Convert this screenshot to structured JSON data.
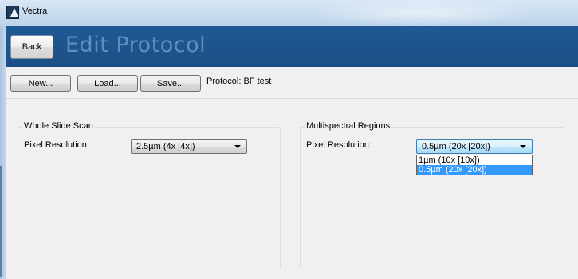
{
  "window": {
    "title": "Vectra"
  },
  "header": {
    "back_label": "Back",
    "title": "Edit Protocol"
  },
  "toolbar": {
    "new_label": "New...",
    "load_label": "Load...",
    "save_label": "Save...",
    "protocol_text": "Protocol: BF test"
  },
  "whole_slide_scan": {
    "group_label": "Whole Slide Scan",
    "field_label": "Pixel Resolution:",
    "selected": "2.5µm (4x [4x])"
  },
  "multispectral_regions": {
    "group_label": "Multispectral Regions",
    "field_label": "Pixel Resolution:",
    "selected": "0.5µm (20x [20x])",
    "options": [
      "1µm (10x [10x])",
      "0.5µm (20x [20x])"
    ],
    "highlighted_option": "0.5µm (20x [20x])"
  },
  "icons": {
    "app_icon": "vectra-app-icon",
    "combo_arrow": "chevron-down-icon"
  },
  "colors": {
    "header_bg": "#1b4f85",
    "title_text": "#5e8ec2",
    "selection": "#3399ff"
  }
}
